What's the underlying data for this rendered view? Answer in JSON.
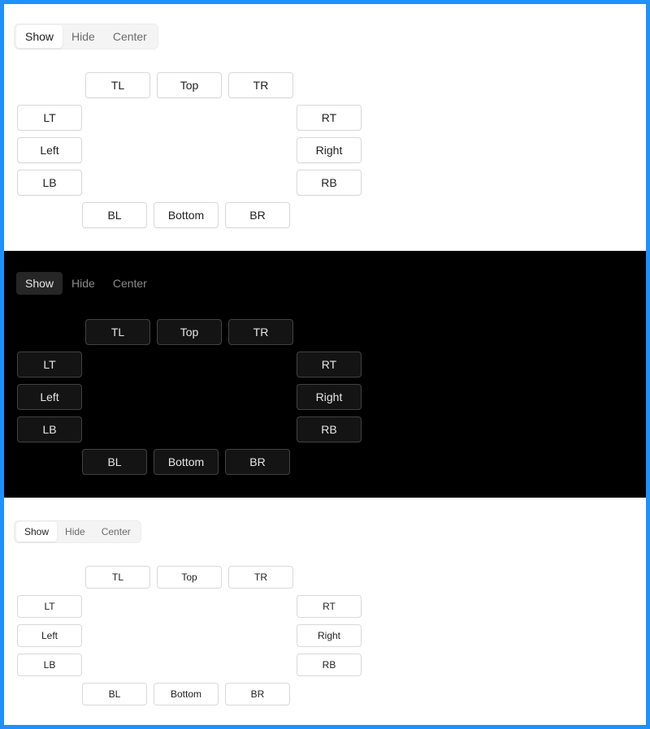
{
  "segmented": {
    "show": "Show",
    "hide": "Hide",
    "center": "Center"
  },
  "placements": {
    "tl": "TL",
    "top": "Top",
    "tr": "TR",
    "lt": "LT",
    "left": "Left",
    "lb": "LB",
    "rt": "RT",
    "right": "Right",
    "rb": "RB",
    "bl": "BL",
    "bottom": "Bottom",
    "br": "BR"
  },
  "colors": {
    "frame_border": "#1e90ff",
    "light_bg": "#ffffff",
    "dark_bg": "#000000"
  }
}
